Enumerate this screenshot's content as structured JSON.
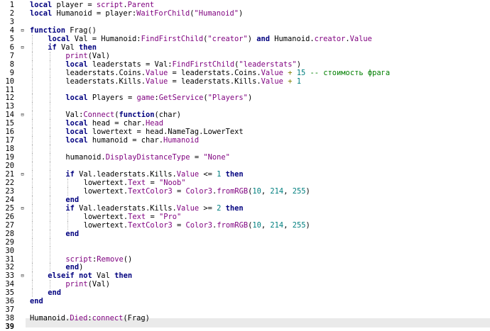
{
  "editor": {
    "current_line": 39,
    "lines": [
      {
        "n": "1",
        "fold": "",
        "indent": 0,
        "code": [
          [
            "kw",
            "local"
          ],
          [
            "t",
            " player = "
          ],
          [
            "bi",
            "script"
          ],
          [
            "t",
            "."
          ],
          [
            "bi",
            "Parent"
          ]
        ]
      },
      {
        "n": "2",
        "fold": "",
        "indent": 0,
        "code": [
          [
            "kw",
            "local"
          ],
          [
            "t",
            " Humanoid = player:"
          ],
          [
            "bi",
            "WaitForChild"
          ],
          [
            "t",
            "("
          ],
          [
            "str",
            "\"Humanoid\""
          ],
          [
            "t",
            ")"
          ]
        ]
      },
      {
        "n": "3",
        "fold": "",
        "indent": 0,
        "code": []
      },
      {
        "n": "4",
        "fold": "⊟",
        "indent": 0,
        "code": [
          [
            "kw",
            "function"
          ],
          [
            "t",
            " Frag()"
          ]
        ]
      },
      {
        "n": "5",
        "fold": "",
        "indent": 1,
        "code": [
          [
            "kw",
            "local"
          ],
          [
            "t",
            " Val = Humanoid:"
          ],
          [
            "bi",
            "FindFirstChild"
          ],
          [
            "t",
            "("
          ],
          [
            "str",
            "\"creator\""
          ],
          [
            "t",
            ") "
          ],
          [
            "kw",
            "and"
          ],
          [
            "t",
            " Humanoid."
          ],
          [
            "bi",
            "creator"
          ],
          [
            "t",
            "."
          ],
          [
            "bi",
            "Value"
          ]
        ]
      },
      {
        "n": "6",
        "fold": "⊟",
        "indent": 1,
        "code": [
          [
            "kw",
            "if"
          ],
          [
            "t",
            " Val "
          ],
          [
            "kw",
            "then"
          ]
        ]
      },
      {
        "n": "7",
        "fold": "",
        "indent": 2,
        "code": [
          [
            "bi",
            "print"
          ],
          [
            "t",
            "(Val)"
          ]
        ]
      },
      {
        "n": "8",
        "fold": "",
        "indent": 2,
        "code": [
          [
            "kw",
            "local"
          ],
          [
            "t",
            " leaderstats = Val:"
          ],
          [
            "bi",
            "FindFirstChild"
          ],
          [
            "t",
            "("
          ],
          [
            "str",
            "\"leaderstats\""
          ],
          [
            "t",
            ")"
          ]
        ]
      },
      {
        "n": "9",
        "fold": "",
        "indent": 2,
        "code": [
          [
            "t",
            "leaderstats.Coins."
          ],
          [
            "bi",
            "Value"
          ],
          [
            "t",
            " = leaderstats.Coins."
          ],
          [
            "bi",
            "Value"
          ],
          [
            "t",
            " "
          ],
          [
            "op",
            "+"
          ],
          [
            "t",
            " "
          ],
          [
            "num",
            "15"
          ],
          [
            "t",
            " "
          ],
          [
            "cm",
            "-- стоимость фрага"
          ]
        ]
      },
      {
        "n": "10",
        "fold": "",
        "indent": 2,
        "code": [
          [
            "t",
            "leaderstats.Kills."
          ],
          [
            "bi",
            "Value"
          ],
          [
            "t",
            " = leaderstats.Kills."
          ],
          [
            "bi",
            "Value"
          ],
          [
            "t",
            " "
          ],
          [
            "op",
            "+"
          ],
          [
            "t",
            " "
          ],
          [
            "num",
            "1"
          ]
        ]
      },
      {
        "n": "11",
        "fold": "",
        "indent": 2,
        "code": []
      },
      {
        "n": "12",
        "fold": "",
        "indent": 2,
        "code": [
          [
            "kw",
            "local"
          ],
          [
            "t",
            " Players = "
          ],
          [
            "bi",
            "game"
          ],
          [
            "t",
            ":"
          ],
          [
            "bi",
            "GetService"
          ],
          [
            "t",
            "("
          ],
          [
            "str",
            "\"Players\""
          ],
          [
            "t",
            ")"
          ]
        ]
      },
      {
        "n": "13",
        "fold": "",
        "indent": 2,
        "code": []
      },
      {
        "n": "14",
        "fold": "⊟",
        "indent": 2,
        "code": [
          [
            "t",
            "Val:"
          ],
          [
            "bi",
            "Connect"
          ],
          [
            "t",
            "("
          ],
          [
            "kw",
            "function"
          ],
          [
            "t",
            "(char)"
          ]
        ]
      },
      {
        "n": "15",
        "fold": "",
        "indent": 2,
        "code": [
          [
            "kw",
            "local"
          ],
          [
            "t",
            " head = char."
          ],
          [
            "bi",
            "Head"
          ]
        ]
      },
      {
        "n": "16",
        "fold": "",
        "indent": 2,
        "code": [
          [
            "kw",
            "local"
          ],
          [
            "t",
            " lowertext = head.NameTag.LowerText"
          ]
        ]
      },
      {
        "n": "17",
        "fold": "",
        "indent": 2,
        "code": [
          [
            "kw",
            "local"
          ],
          [
            "t",
            " humanoid = char."
          ],
          [
            "bi",
            "Humanoid"
          ]
        ]
      },
      {
        "n": "18",
        "fold": "",
        "indent": 2,
        "code": []
      },
      {
        "n": "19",
        "fold": "",
        "indent": 2,
        "code": [
          [
            "t",
            "humanoid."
          ],
          [
            "bi",
            "DisplayDistanceType"
          ],
          [
            "t",
            " = "
          ],
          [
            "str",
            "\"None\""
          ]
        ]
      },
      {
        "n": "20",
        "fold": "",
        "indent": 2,
        "code": []
      },
      {
        "n": "21",
        "fold": "⊟",
        "indent": 2,
        "code": [
          [
            "kw",
            "if"
          ],
          [
            "t",
            " Val.leaderstats.Kills."
          ],
          [
            "bi",
            "Value"
          ],
          [
            "t",
            " <= "
          ],
          [
            "num",
            "1"
          ],
          [
            "t",
            " "
          ],
          [
            "kw",
            "then"
          ]
        ]
      },
      {
        "n": "22",
        "fold": "",
        "indent": 3,
        "code": [
          [
            "t",
            "lowertext."
          ],
          [
            "bi",
            "Text"
          ],
          [
            "t",
            " = "
          ],
          [
            "str",
            "\"Noob\""
          ]
        ]
      },
      {
        "n": "23",
        "fold": "",
        "indent": 3,
        "code": [
          [
            "t",
            "lowertext."
          ],
          [
            "bi",
            "TextColor3"
          ],
          [
            "t",
            " = "
          ],
          [
            "bi",
            "Color3"
          ],
          [
            "t",
            "."
          ],
          [
            "bi",
            "fromRGB"
          ],
          [
            "t",
            "("
          ],
          [
            "num",
            "10"
          ],
          [
            "t",
            ", "
          ],
          [
            "num",
            "214"
          ],
          [
            "t",
            ", "
          ],
          [
            "num",
            "255"
          ],
          [
            "t",
            ")"
          ]
        ]
      },
      {
        "n": "24",
        "fold": "",
        "indent": 2,
        "code": [
          [
            "kw",
            "end"
          ]
        ]
      },
      {
        "n": "25",
        "fold": "⊟",
        "indent": 2,
        "code": [
          [
            "kw",
            "if"
          ],
          [
            "t",
            " Val.leaderstats.Kills."
          ],
          [
            "bi",
            "Value"
          ],
          [
            "t",
            " >= "
          ],
          [
            "num",
            "2"
          ],
          [
            "t",
            " "
          ],
          [
            "kw",
            "then"
          ]
        ]
      },
      {
        "n": "26",
        "fold": "",
        "indent": 3,
        "code": [
          [
            "t",
            "lowertext."
          ],
          [
            "bi",
            "Text"
          ],
          [
            "t",
            " = "
          ],
          [
            "str",
            "\"Pro\""
          ]
        ]
      },
      {
        "n": "27",
        "fold": "",
        "indent": 3,
        "code": [
          [
            "t",
            "lowertext."
          ],
          [
            "bi",
            "TextColor3"
          ],
          [
            "t",
            " = "
          ],
          [
            "bi",
            "Color3"
          ],
          [
            "t",
            "."
          ],
          [
            "bi",
            "fromRGB"
          ],
          [
            "t",
            "("
          ],
          [
            "num",
            "10"
          ],
          [
            "t",
            ", "
          ],
          [
            "num",
            "214"
          ],
          [
            "t",
            ", "
          ],
          [
            "num",
            "255"
          ],
          [
            "t",
            ")"
          ]
        ]
      },
      {
        "n": "28",
        "fold": "",
        "indent": 2,
        "code": [
          [
            "kw",
            "end"
          ]
        ]
      },
      {
        "n": "29",
        "fold": "",
        "indent": 2,
        "code": []
      },
      {
        "n": "30",
        "fold": "",
        "indent": 2,
        "code": []
      },
      {
        "n": "31",
        "fold": "",
        "indent": 2,
        "code": [
          [
            "bi",
            "script"
          ],
          [
            "t",
            ":"
          ],
          [
            "bi",
            "Remove"
          ],
          [
            "t",
            "()"
          ]
        ]
      },
      {
        "n": "32",
        "fold": "",
        "indent": 2,
        "code": [
          [
            "kw",
            "end"
          ],
          [
            "t",
            ")"
          ]
        ]
      },
      {
        "n": "33",
        "fold": "⊟",
        "indent": 1,
        "code": [
          [
            "kw",
            "elseif"
          ],
          [
            "t",
            " "
          ],
          [
            "kw",
            "not"
          ],
          [
            "t",
            " Val "
          ],
          [
            "kw",
            "then"
          ]
        ]
      },
      {
        "n": "34",
        "fold": "",
        "indent": 2,
        "code": [
          [
            "bi",
            "print"
          ],
          [
            "t",
            "(Val)"
          ]
        ]
      },
      {
        "n": "35",
        "fold": "",
        "indent": 1,
        "code": [
          [
            "kw",
            "end"
          ]
        ]
      },
      {
        "n": "36",
        "fold": "",
        "indent": 0,
        "code": [
          [
            "kw",
            "end"
          ]
        ]
      },
      {
        "n": "37",
        "fold": "",
        "indent": 0,
        "code": []
      },
      {
        "n": "38",
        "fold": "",
        "indent": 0,
        "code": [
          [
            "t",
            "Humanoid."
          ],
          [
            "bi",
            "Died"
          ],
          [
            "t",
            ":"
          ],
          [
            "bi",
            "connect"
          ],
          [
            "t",
            "(Frag)"
          ]
        ]
      },
      {
        "n": "39",
        "fold": "",
        "indent": 0,
        "code": []
      }
    ]
  }
}
